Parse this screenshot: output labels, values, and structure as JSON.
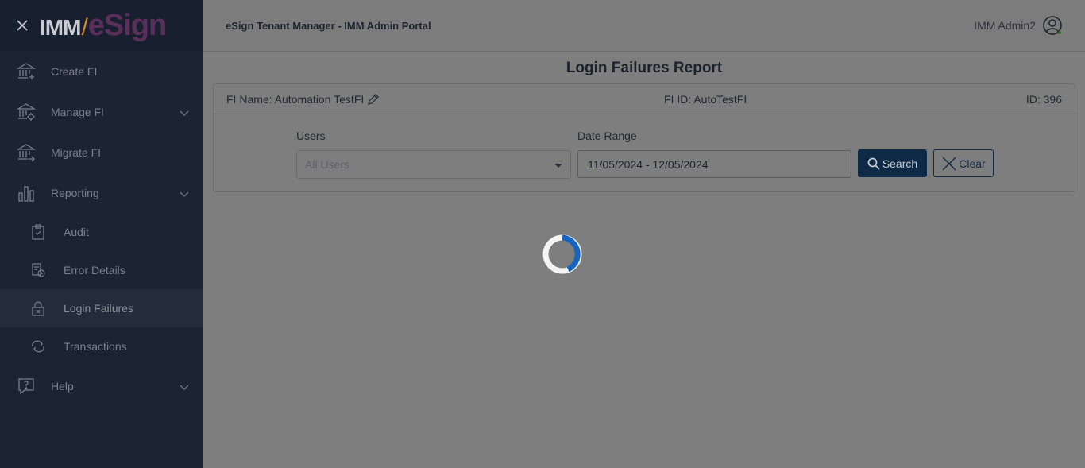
{
  "brand": {
    "imm": "IMM",
    "slash": "/",
    "esign": "eSign"
  },
  "sidebar": {
    "items": [
      {
        "label": "Create FI",
        "icon": "bank-add-icon"
      },
      {
        "label": "Manage FI",
        "icon": "bank-gear-icon"
      },
      {
        "label": "Migrate FI",
        "icon": "bank-arrow-icon"
      },
      {
        "label": "Reporting",
        "icon": "bar-chart-icon"
      },
      {
        "label": "Help",
        "icon": "help-bubble-icon"
      }
    ],
    "reporting_sub": [
      {
        "label": "Audit",
        "icon": "clipboard-check-icon"
      },
      {
        "label": "Error Details",
        "icon": "doc-clock-icon"
      },
      {
        "label": "Login Failures",
        "icon": "lock-x-icon",
        "active": true
      },
      {
        "label": "Transactions",
        "icon": "refresh-icon"
      }
    ]
  },
  "header": {
    "portal_title": "eSign Tenant Manager - IMM Admin Portal",
    "user_name": "IMM Admin2"
  },
  "page": {
    "title": "Login Failures Report",
    "fi_name": "FI Name: Automation TestFI",
    "fi_id": "FI ID: AutoTestFI",
    "id": "ID: 396"
  },
  "filters": {
    "users_label": "Users",
    "users_value": "All Users",
    "date_label": "Date Range",
    "date_value": "11/05/2024 - 12/05/2024",
    "search_label": "Search",
    "clear_label": "Clear"
  },
  "colors": {
    "sidebar_bg": "#1c2433",
    "primary": "#0e2a47",
    "spinner": "#1565c0"
  }
}
